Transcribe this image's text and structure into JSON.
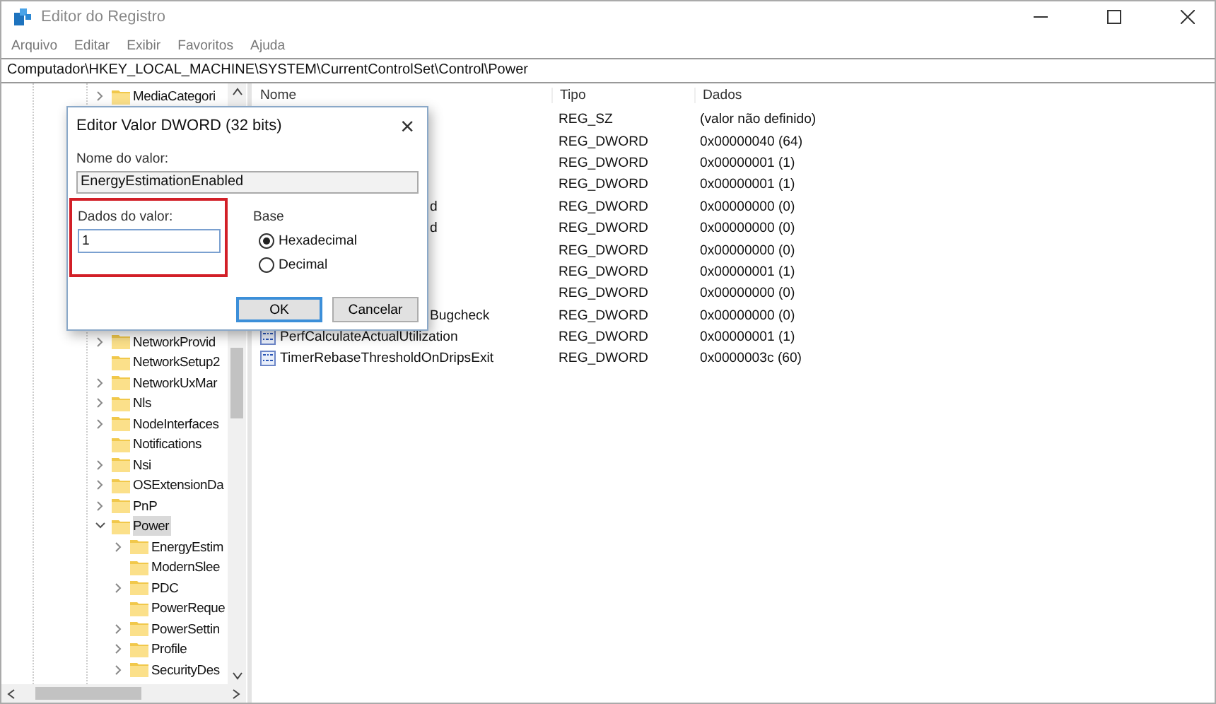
{
  "window": {
    "title": "Editor do Registro"
  },
  "menu": [
    "Arquivo",
    "Editar",
    "Exibir",
    "Favoritos",
    "Ajuda"
  ],
  "address": "Computador\\HKEY_LOCAL_MACHINE\\SYSTEM\\CurrentControlSet\\Control\\Power",
  "tree": {
    "top_item": {
      "label": "MediaCategori",
      "kind": "branch",
      "expanded": false,
      "selected": false
    },
    "items": [
      {
        "label": "NetworkProvid",
        "kind": "branch",
        "expanded": false,
        "selected": false
      },
      {
        "label": "NetworkSetup2",
        "kind": "leaf",
        "selected": false
      },
      {
        "label": "NetworkUxMar",
        "kind": "branch",
        "expanded": false,
        "selected": false
      },
      {
        "label": "Nls",
        "kind": "branch",
        "expanded": false,
        "selected": false
      },
      {
        "label": "NodeInterfaces",
        "kind": "branch",
        "expanded": false,
        "selected": false
      },
      {
        "label": "Notifications",
        "kind": "leaf",
        "selected": false
      },
      {
        "label": "Nsi",
        "kind": "branch",
        "expanded": false,
        "selected": false
      },
      {
        "label": "OSExtensionDa",
        "kind": "branch",
        "expanded": false,
        "selected": false
      },
      {
        "label": "PnP",
        "kind": "branch",
        "expanded": false,
        "selected": false
      },
      {
        "label": "Power",
        "kind": "branch",
        "expanded": true,
        "selected": true,
        "children": [
          {
            "label": "EnergyEstim",
            "kind": "branch",
            "expanded": false,
            "selected": false
          },
          {
            "label": "ModernSlee",
            "kind": "leaf",
            "selected": false
          },
          {
            "label": "PDC",
            "kind": "branch",
            "expanded": false,
            "selected": false
          },
          {
            "label": "PowerReque",
            "kind": "leaf",
            "selected": false
          },
          {
            "label": "PowerSettin",
            "kind": "branch",
            "expanded": false,
            "selected": false
          },
          {
            "label": "Profile",
            "kind": "branch",
            "expanded": false,
            "selected": false
          },
          {
            "label": "SecurityDes",
            "kind": "branch",
            "expanded": false,
            "selected": false
          }
        ]
      }
    ]
  },
  "table": {
    "columns": [
      "Nome",
      "Tipo",
      "Dados"
    ],
    "rows": [
      {
        "kind": "covered",
        "type": "REG_SZ",
        "data": "(valor não definido)"
      },
      {
        "kind": "covered",
        "type": "REG_DWORD",
        "data": "0x00000040 (64)"
      },
      {
        "kind": "covered",
        "type": "REG_DWORD",
        "data": "0x00000001 (1)"
      },
      {
        "kind": "covered",
        "type": "REG_DWORD",
        "data": "0x00000001 (1)"
      },
      {
        "kind": "covered",
        "name": "d",
        "type": "REG_DWORD",
        "data": "0x00000000 (0)"
      },
      {
        "kind": "covered",
        "name": "d",
        "type": "REG_DWORD",
        "data": "0x00000000 (0)"
      },
      {
        "kind": "covered",
        "type": "REG_DWORD",
        "data": "0x00000000 (0)"
      },
      {
        "kind": "covered",
        "type": "REG_DWORD",
        "data": "0x00000001 (1)"
      },
      {
        "kind": "covered",
        "type": "REG_DWORD",
        "data": "0x00000000 (0)"
      },
      {
        "kind": "covered",
        "name": "Bugcheck",
        "type": "REG_DWORD",
        "data": "0x00000000 (0)"
      },
      {
        "kind": "value",
        "name": "PerfCalculateActualUtilization",
        "type": "REG_DWORD",
        "data": "0x00000001 (1)"
      },
      {
        "kind": "value",
        "name": "TimerRebaseThresholdOnDripsExit",
        "type": "REG_DWORD",
        "data": "0x0000003c (60)"
      }
    ]
  },
  "dialog": {
    "title": "Editor Valor DWORD (32 bits)",
    "close": "×",
    "name_label": "Nome do valor:",
    "name_value": "EnergyEstimationEnabled",
    "data_label": "Dados do valor:",
    "data_value": "1",
    "highlighted": true,
    "base_label": "Base",
    "base_options": [
      {
        "label": "Hexadecimal",
        "selected": true
      },
      {
        "label": "Decimal",
        "selected": false
      }
    ],
    "buttons": [
      {
        "label": "OK",
        "default": true
      },
      {
        "label": "Cancelar",
        "default": false
      }
    ]
  }
}
